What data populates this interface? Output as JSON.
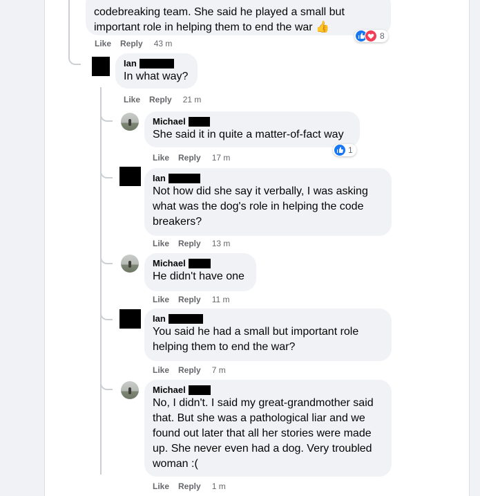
{
  "colors": {
    "like_blue": "#1877f2",
    "love_red": "#f33e58",
    "bubble": "#f0f2f5",
    "muted": "#65676b"
  },
  "labels": {
    "like": "Like",
    "reply": "Reply"
  },
  "comments": [
    {
      "author": "",
      "text_lines": [
        "codebreaking team. She said he played a small but",
        "important role in helping them to end the war 👍"
      ],
      "time": "43 m",
      "reactions": {
        "icons": [
          "like-icon",
          "love-icon"
        ],
        "count": "8"
      }
    },
    {
      "author": "Ian",
      "text_lines": [
        "In what way?"
      ],
      "time": "21 m"
    },
    {
      "author": "Michael",
      "text_lines": [
        "She said it in quite a matter-of-fact way"
      ],
      "time": "17 m",
      "reactions": {
        "icons": [
          "like-icon"
        ],
        "count": "1"
      }
    },
    {
      "author": "Ian",
      "text_lines": [
        "Not how did she say it verbally, I was asking",
        "what was the dog's role in helping the code",
        "breakers?"
      ],
      "time": "13 m"
    },
    {
      "author": "Michael",
      "text_lines": [
        "He didn't have one"
      ],
      "time": "11 m"
    },
    {
      "author": "Ian",
      "text_lines": [
        "You said he had a small but important role",
        "helping them to end the war?"
      ],
      "time": "7 m"
    },
    {
      "author": "Michael",
      "text_lines": [
        "No, I didn't. I said my great-grandmother said",
        "that. But she was a pathological liar and we",
        "found out later that all her stories were made",
        "up. She never even had a dog. Very troubled",
        "woman :("
      ],
      "time": "1 m"
    }
  ]
}
